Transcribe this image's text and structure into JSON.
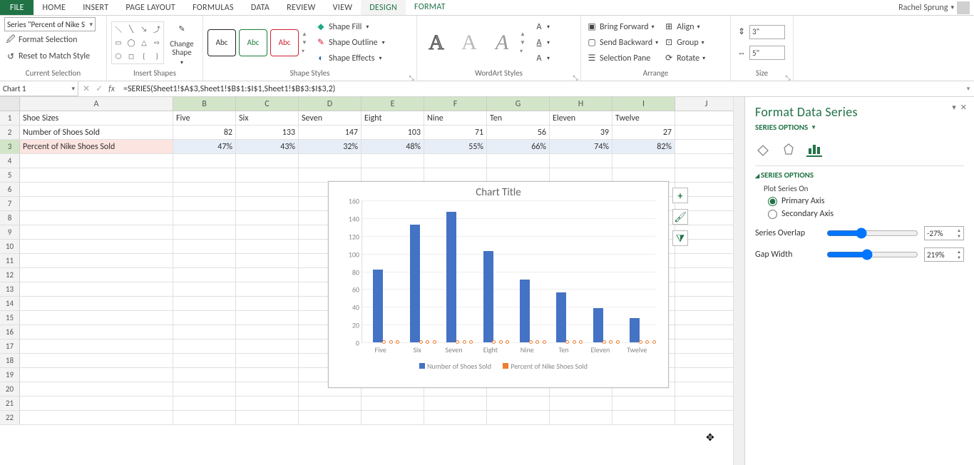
{
  "tabs": {
    "file": "FILE",
    "items": [
      "HOME",
      "INSERT",
      "PAGE LAYOUT",
      "FORMULAS",
      "DATA",
      "REVIEW",
      "VIEW",
      "DESIGN",
      "FORMAT"
    ],
    "active": "FORMAT"
  },
  "user": "Rachel Sprung",
  "ribbon": {
    "currentSelection": {
      "combo": "Series \"Percent of Nike S",
      "formatSelection": "Format Selection",
      "resetMatch": "Reset to Match Style",
      "label": "Current Selection"
    },
    "insertShapes": {
      "changeShape": "Change Shape",
      "label": "Insert Shapes"
    },
    "shapeStyles": {
      "abc": "Abc",
      "shapeFill": "Shape Fill",
      "shapeOutline": "Shape Outline",
      "shapeEffects": "Shape Effects",
      "label": "Shape Styles"
    },
    "wordart": {
      "label": "WordArt Styles"
    },
    "arrange": {
      "bringForward": "Bring Forward",
      "sendBackward": "Send Backward",
      "selectionPane": "Selection Pane",
      "align": "Align",
      "group": "Group",
      "rotate": "Rotate",
      "label": "Arrange"
    },
    "size": {
      "h": "3\"",
      "w": "5\"",
      "label": "Size"
    }
  },
  "formulaBar": {
    "name": "Chart 1",
    "formula": "=SERIES(Sheet1!$A$3,Sheet1!$B$1:$I$1,Sheet1!$B$3:$I$3,2)"
  },
  "grid": {
    "colWidths": {
      "A": 215,
      "other": 88
    },
    "columns": [
      "A",
      "B",
      "C",
      "D",
      "E",
      "F",
      "G",
      "H",
      "I",
      "J"
    ],
    "rows": [
      {
        "h": "1",
        "A": "Shoe Sizes",
        "vals": [
          "Five",
          "Six",
          "Seven",
          "Eight",
          "Nine",
          "Ten",
          "Eleven",
          "Twelve"
        ],
        "txt": true
      },
      {
        "h": "2",
        "A": "Number of Shoes Sold",
        "vals": [
          "82",
          "133",
          "147",
          "103",
          "71",
          "56",
          "39",
          "27"
        ]
      },
      {
        "h": "3",
        "A": "Percent of Nike Shoes Sold",
        "vals": [
          "47%",
          "43%",
          "32%",
          "48%",
          "55%",
          "66%",
          "74%",
          "82%"
        ],
        "selected": true
      }
    ],
    "blankRows": 19
  },
  "chart_data": {
    "type": "bar",
    "title": "Chart Title",
    "categories": [
      "Five",
      "Six",
      "Seven",
      "Eight",
      "Nine",
      "Ten",
      "Eleven",
      "Twelve"
    ],
    "series": [
      {
        "name": "Number of Shoes Sold",
        "values": [
          82,
          133,
          147,
          103,
          71,
          56,
          39,
          27
        ],
        "color": "#4472c4"
      },
      {
        "name": "Percent of Nike Shoes Sold",
        "values": [
          0.47,
          0.43,
          0.32,
          0.48,
          0.55,
          0.66,
          0.74,
          0.82
        ],
        "color": "#ed7d31"
      }
    ],
    "ylim": [
      0,
      160
    ],
    "yticks": [
      0,
      20,
      40,
      60,
      80,
      100,
      120,
      140,
      160
    ]
  },
  "taskPane": {
    "title": "Format Data Series",
    "link": "SERIES OPTIONS",
    "section": "SERIES OPTIONS",
    "plotOn": "Plot Series On",
    "primary": "Primary Axis",
    "secondary": "Secondary Axis",
    "overlapLabel": "Series Overlap",
    "overlap": "-27%",
    "gapLabel": "Gap Width",
    "gap": "219%"
  }
}
